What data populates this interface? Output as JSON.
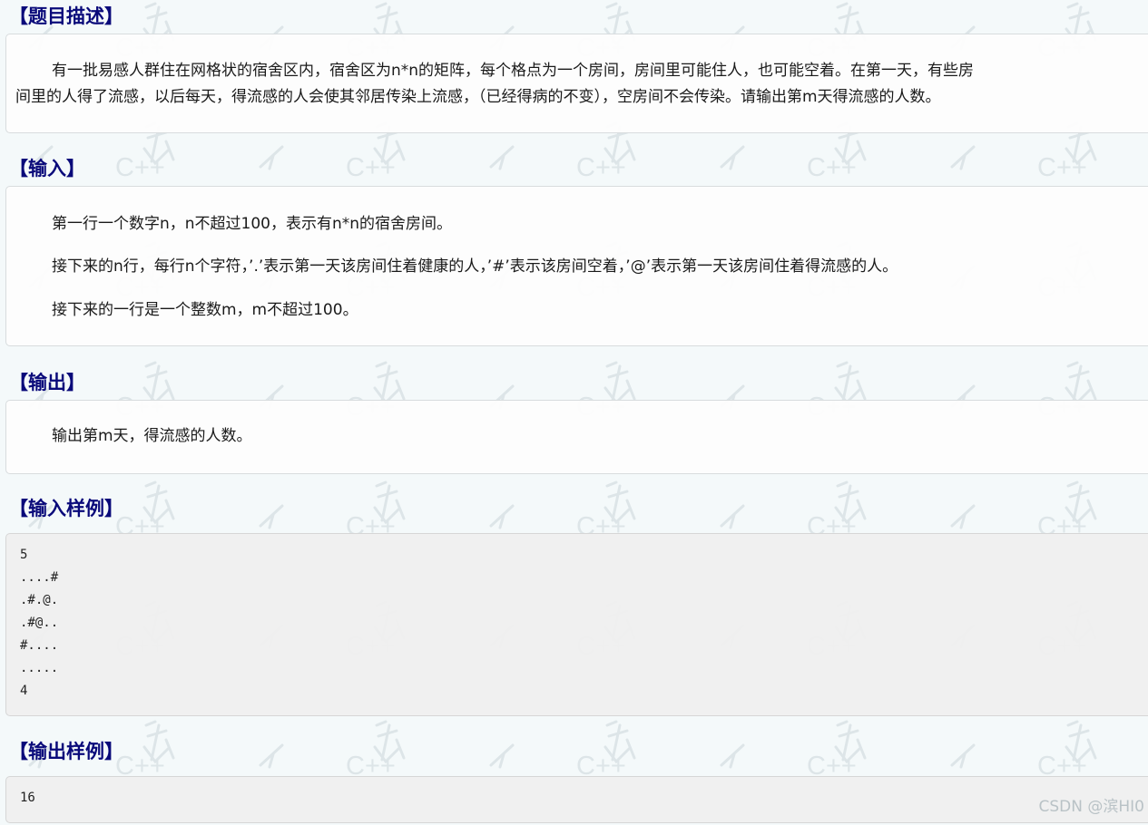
{
  "watermark": {
    "text": "C++"
  },
  "sections": {
    "description": {
      "title": "【题目描述】",
      "lines": [
        "有一批易感人群住在网格状的宿舍区内，宿舍区为n*n的矩阵，每个格点为一个房间，房间里可能住人，也可能空着。在第一天，有些房",
        "间里的人得了流感，以后每天，得流感的人会使其邻居传染上流感，（已经得病的不变），空房间不会传染。请输出第m天得流感的人数。"
      ]
    },
    "input": {
      "title": "【输入】",
      "paragraphs": [
        "第一行一个数字n，n不超过100，表示有n*n的宿舍房间。",
        "接下来的n行，每行n个字符，’.’表示第一天该房间住着健康的人，’#’表示该房间空着，’@’表示第一天该房间住着得流感的人。",
        "接下来的一行是一个整数m，m不超过100。"
      ]
    },
    "output": {
      "title": "【输出】",
      "paragraphs": [
        "输出第m天，得流感的人数。"
      ]
    },
    "sample_input": {
      "title": "【输入样例】",
      "lines": [
        "5",
        "....#",
        ".#.@.",
        ".#@..",
        "#....",
        ".....",
        "4"
      ]
    },
    "sample_output": {
      "title": "【输出样例】",
      "lines": [
        "16"
      ]
    }
  },
  "credit": "CSDN @滨HI0"
}
